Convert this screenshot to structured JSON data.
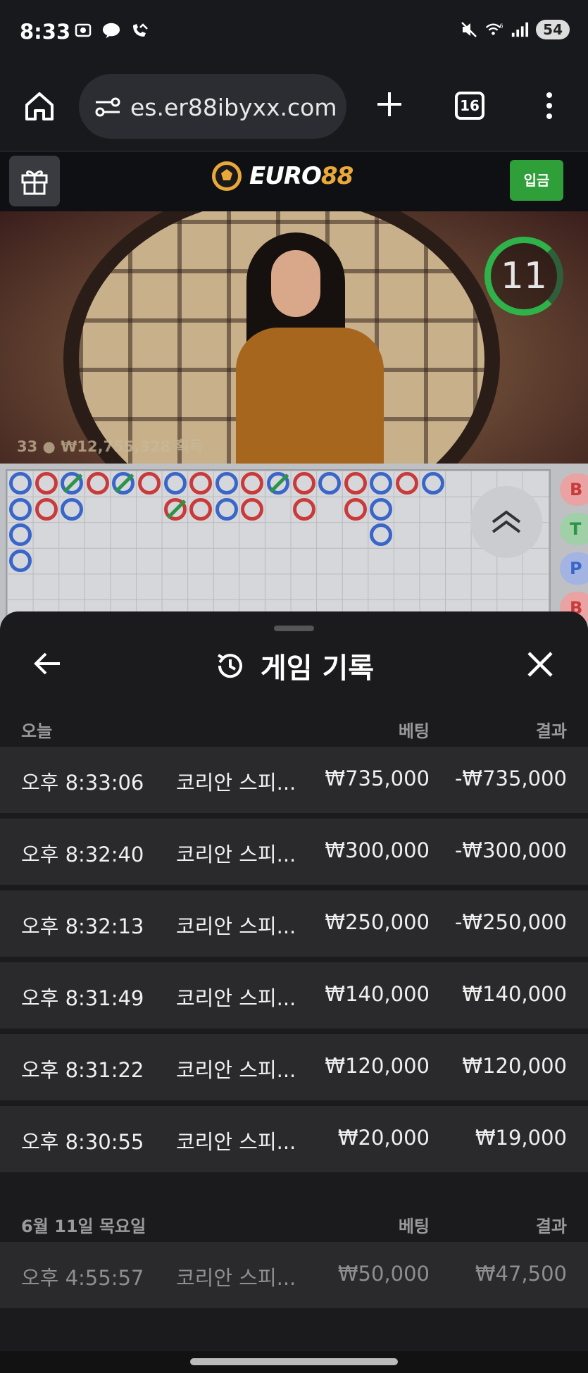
{
  "status_bar": {
    "time": "8:33",
    "battery": "54",
    "wifi_label": "6"
  },
  "browser": {
    "url": "es.er88ibyxx.com",
    "tab_count": "16"
  },
  "site": {
    "logo_main": "EURO",
    "logo_accent": "88",
    "deposit_label": "입금"
  },
  "video": {
    "timer": "11",
    "players_count": "33",
    "win_amount": "₩12,755,328",
    "win_suffix": "획득"
  },
  "road": {
    "side_labels": [
      "B",
      "T",
      "P",
      "B"
    ]
  },
  "sheet": {
    "title": "게임 기록",
    "today": {
      "label": "오늘",
      "bet_header": "베팅",
      "result_header": "결과",
      "rows": [
        {
          "time": "오후 8:33:06",
          "game": "코리안 스피...",
          "bet": "₩735,000",
          "result": "-₩735,000"
        },
        {
          "time": "오후 8:32:40",
          "game": "코리안 스피...",
          "bet": "₩300,000",
          "result": "-₩300,000"
        },
        {
          "time": "오후 8:32:13",
          "game": "코리안 스피...",
          "bet": "₩250,000",
          "result": "-₩250,000"
        },
        {
          "time": "오후 8:31:49",
          "game": "코리안 스피...",
          "bet": "₩140,000",
          "result": "₩140,000"
        },
        {
          "time": "오후 8:31:22",
          "game": "코리안 스피...",
          "bet": "₩120,000",
          "result": "₩120,000"
        },
        {
          "time": "오후 8:30:55",
          "game": "코리안 스피...",
          "bet": "₩20,000",
          "result": "₩19,000"
        }
      ]
    },
    "earlier": {
      "label": "6월 11일 목요일",
      "bet_header": "베팅",
      "result_header": "결과",
      "rows": [
        {
          "time": "오후 4:55:57",
          "game": "코리안 스피...",
          "bet": "₩50,000",
          "result": "₩47,500"
        }
      ]
    }
  }
}
